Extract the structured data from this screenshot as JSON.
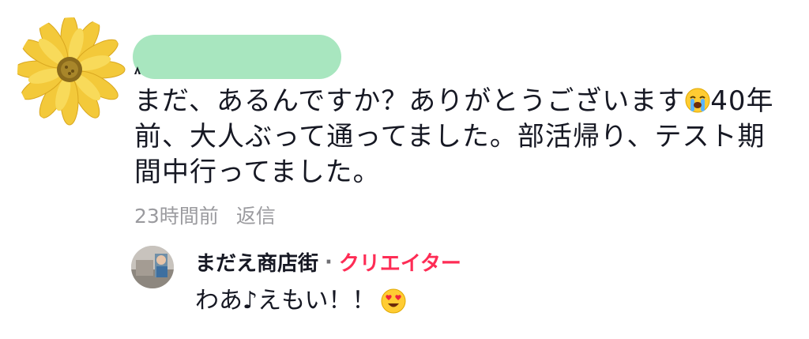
{
  "comment": {
    "avatar_icon": "sunflower-icon",
    "text_part1": "まだ、あるんですか？ありがとうございます",
    "emoji1": "loudly-crying-face-emoji",
    "text_part2": "40年前、大人ぶって通ってました。部活帰り、テスト期間中行ってました。",
    "time": "23時間前",
    "reply_label": "返信"
  },
  "reply": {
    "avatar_icon": "user-avatar",
    "author": "まだえ商店街",
    "separator": "·",
    "badge": "クリエイター",
    "text": "わあ♪えもい！！",
    "emoji": "heart-eyes-emoji"
  },
  "colors": {
    "redaction": "#a8e6bf",
    "creator_badge": "#fe2c55",
    "meta_text": "#9b9b9f",
    "primary_text": "#161823"
  }
}
